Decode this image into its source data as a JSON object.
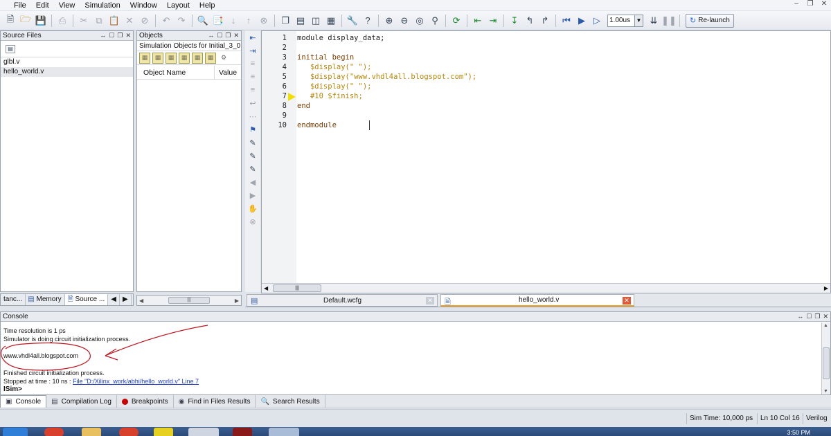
{
  "menu": [
    "File",
    "Edit",
    "View",
    "Simulation",
    "Window",
    "Layout",
    "Help"
  ],
  "toolbar": {
    "time_value": "1.00us",
    "relaunch_label": "Re-launch"
  },
  "source_panel": {
    "title": "Source Files",
    "files": [
      "glbl.v",
      "hello_world.v"
    ],
    "tabs": [
      "tanc...",
      "Memory",
      "Source ..."
    ]
  },
  "objects_panel": {
    "title": "Objects",
    "subtitle": "Simulation Objects for Initial_3_0",
    "columns": [
      "Object Name",
      "Value"
    ]
  },
  "editor": {
    "line_numbers": [
      "1",
      "2",
      "3",
      "4",
      "5",
      "6",
      "7",
      "8",
      "9",
      "10"
    ],
    "lines": [
      "module display_data;",
      "",
      "initial begin",
      "   $display(\" \");",
      "   $display(\"www.vhdl4all.blogspot.com\");",
      "   $display(\" \");",
      "   #10 $finish;",
      "end",
      "",
      "endmodule"
    ],
    "tabs": [
      "Default.wcfg",
      "hello_world.v"
    ],
    "active_tab": "hello_world.v",
    "current_line": 7
  },
  "console": {
    "title": "Console",
    "line1": "Time resolution is 1 ps",
    "line2": "Simulator is doing circuit initialization process.",
    "line3": "www.vhdl4all.blogspot.com",
    "line4": "Finished circuit initialization process.",
    "line5_prefix": "Stopped at time : 10 ns : ",
    "line5_link": "File \"D:/Xilinx_work/abhi/hello_world.v\" Line 7",
    "prompt": "ISim>"
  },
  "bottom_tabs": [
    "Console",
    "Compilation Log",
    "Breakpoints",
    "Find in Files Results",
    "Search Results"
  ],
  "status": {
    "sim_time": "Sim Time: 10,000 ps",
    "position": "Ln 10 Col 16",
    "language": "Verilog"
  },
  "taskbar": {
    "clock": "3:50 PM"
  },
  "colors": {
    "keyword": "#7a3d00",
    "system_task": "#b8860b",
    "annotation": "#c0141e",
    "marker": "#f0e000"
  }
}
